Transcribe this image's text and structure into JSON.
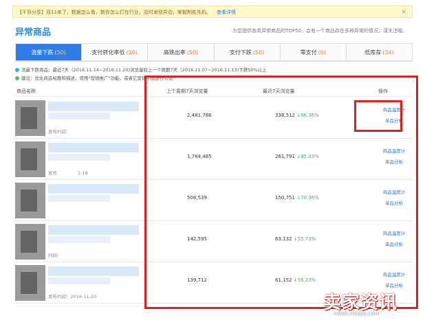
{
  "notice": {
    "text": "【干货分享】双11来了，数据怎么看，数你怎么打在行业，及时发现异动，掌握制胜先机。",
    "link": "查看详情",
    "close": "×"
  },
  "page": {
    "title": "异常商品",
    "subtitle": "为您提供各类异常商品的TOP50，会有一个商品存在多种异常的情况，请关注哦。"
  },
  "tabs": [
    {
      "label": "流量下跌",
      "count": "(50)",
      "active": true
    },
    {
      "label": "支付转化率低",
      "count": "(50)"
    },
    {
      "label": "高跳出率",
      "count": "(50)"
    },
    {
      "label": "支付下跌",
      "count": "(50)"
    },
    {
      "label": "零支付",
      "count": "(0)"
    },
    {
      "label": "低库存",
      "count": "(34)"
    }
  ],
  "info": {
    "line1": "流量下跌商品：最近7天（2016.11.14~2016.11.20)浏览量较上一个周期7天（2016.11.07~2016.11.13)下跌50%以上",
    "line2": "建议：优化商品标题和描述，使用\"营销推广\"功能，或者它营销手段进行引流"
  },
  "columns": {
    "name": "商品名称",
    "prev": "上个周期7天浏览量",
    "recent": "最近7天浏览量",
    "ops": "操作"
  },
  "rows": [
    {
      "time": "发布时间:",
      "prev": "2,481,786",
      "recent": "338,512",
      "change": "86.36%",
      "op1": "商品温度计",
      "op2": "单品分析"
    },
    {
      "time": "发布",
      "time2": "1-18",
      "prev": "1,784,485",
      "recent": "261,791",
      "change": "85.33%",
      "op1": "商品温度计",
      "op2": "单品分析"
    },
    {
      "time": "",
      "prev": "508,539",
      "recent": "150,751",
      "change": "70.36%",
      "op1": "商品温度计",
      "op2": "单品分析"
    },
    {
      "time": "时间:",
      "prev": "142,595",
      "recent": "63,132",
      "change": "55.73%",
      "op1": "商品温度计",
      "op2": "单品分析"
    },
    {
      "time": "发布时间：2016-11-20",
      "prev": "139,712",
      "recent": "61,152",
      "change": "56.23%",
      "op1": "商品温度计",
      "op2": "单品分析"
    }
  ],
  "watermark": {
    "main": "卖家资讯",
    "url": "news.maijia.com"
  },
  "colors": {
    "accent": "#2f7ee7",
    "highlight": "#e21f1f",
    "up": "#3cbc4a"
  }
}
